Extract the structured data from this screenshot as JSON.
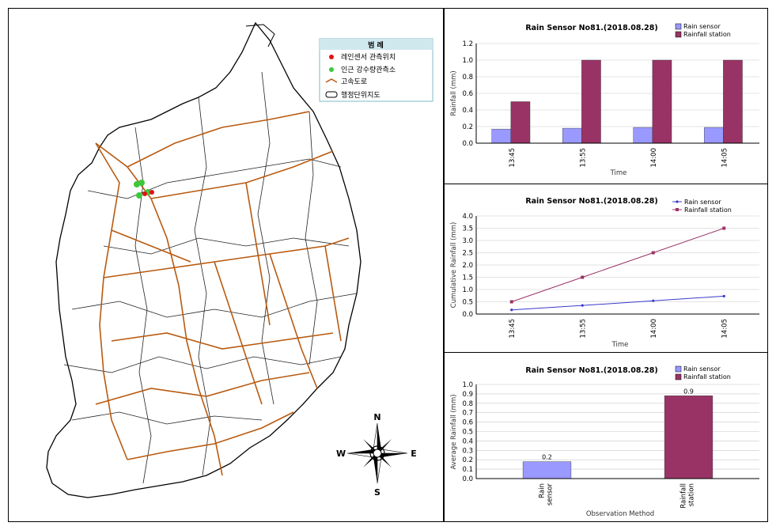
{
  "map": {
    "legend": {
      "title": "범 례",
      "items": [
        {
          "label": "레인센서 관측위치",
          "color": "#e41010"
        },
        {
          "label": "인근 강수량관측소",
          "color": "#3cc83c"
        },
        {
          "label": "고속도로",
          "color": "#b85a10"
        },
        {
          "label": "행정단위지도",
          "color": "#000000"
        }
      ]
    },
    "compass": {
      "n": "N",
      "s": "S",
      "e": "E",
      "w": "W"
    }
  },
  "colors": {
    "rain_sensor": "#9999ff",
    "rainfall_station": "#993366",
    "road": "#b85a10"
  },
  "chart_data": [
    {
      "type": "bar",
      "title": "Rain Sensor No81.(2018.08.28)",
      "xlabel": "Time",
      "ylabel": "Rainfall (mm)",
      "categories": [
        "13:45",
        "13:55",
        "14:00",
        "14:05"
      ],
      "series": [
        {
          "name": "Rain sensor",
          "values": [
            0.17,
            0.18,
            0.19,
            0.19
          ]
        },
        {
          "name": "Rainfall station",
          "values": [
            0.5,
            1.0,
            1.0,
            1.0
          ]
        }
      ],
      "ylim": [
        0,
        1.2
      ],
      "yticks": [
        "0.0",
        "0.2",
        "0.4",
        "0.6",
        "0.8",
        "1.0",
        "1.2"
      ],
      "legend": "top-right",
      "grid": true
    },
    {
      "type": "line",
      "title": "Rain Sensor No81.(2018.08.28)",
      "xlabel": "Time",
      "ylabel": "Cumulative Rainfall (mm)",
      "categories": [
        "13:45",
        "13:55",
        "14:00",
        "14:05"
      ],
      "series": [
        {
          "name": "Rain sensor",
          "values": [
            0.17,
            0.35,
            0.54,
            0.73
          ]
        },
        {
          "name": "Rainfall station",
          "values": [
            0.5,
            1.5,
            2.5,
            3.5
          ]
        }
      ],
      "ylim": [
        0,
        4.0
      ],
      "yticks": [
        "0.0",
        "0.5",
        "1.0",
        "1.5",
        "2.0",
        "2.5",
        "3.0",
        "3.5",
        "4.0"
      ],
      "legend": "top-right",
      "grid": true
    },
    {
      "type": "bar",
      "title": "Rain Sensor No81.(2018.08.28)",
      "xlabel": "Observation Method",
      "ylabel": "Average Rainfall (mm)",
      "categories": [
        "Rain sensor",
        "Rainfall station"
      ],
      "series": [
        {
          "name": "Rain sensor",
          "values": [
            0.18
          ]
        },
        {
          "name": "Rainfall station",
          "values": [
            0.88
          ]
        }
      ],
      "data_labels": [
        "0.2",
        "0.9"
      ],
      "ylim": [
        0,
        1.0
      ],
      "yticks": [
        "0.0",
        "0.1",
        "0.2",
        "0.3",
        "0.4",
        "0.5",
        "0.6",
        "0.7",
        "0.8",
        "0.9",
        "1.0"
      ],
      "legend": "top-right",
      "grid": true
    }
  ]
}
